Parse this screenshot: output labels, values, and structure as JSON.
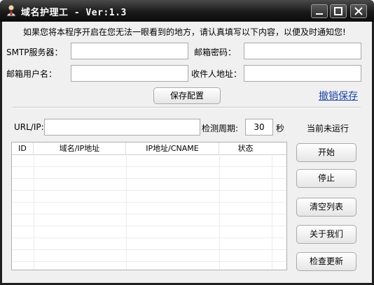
{
  "window": {
    "title": "域名护理工 - Ver:1.3"
  },
  "notice": "如果您将本程序开启在您无法一眼看到的地方，请认真填写以下内容，以便及时通知您!",
  "form": {
    "smtp_label": "SMTP服务器：",
    "smtp_value": "",
    "mail_password_label": "邮箱密码：",
    "mail_password_value": "",
    "mail_user_label": "邮箱用户名：",
    "mail_user_value": "",
    "recipient_label": "收件人地址：",
    "recipient_value": "",
    "save_config_label": "保存配置",
    "undo_save_label": "撤销保存"
  },
  "monitor": {
    "url_label": "URL/IP:",
    "url_value": "",
    "period_label": "检测周期:",
    "period_value": "30",
    "period_unit": "秒",
    "status_text": "当前未运行"
  },
  "table": {
    "columns": [
      "ID",
      "域名/IP地址",
      "IP地址/CNAME",
      "状态"
    ],
    "rows": []
  },
  "actions": {
    "start": "开始",
    "stop": "停止",
    "clear_list": "清空列表",
    "about": "关于我们",
    "check_update": "检查更新"
  }
}
